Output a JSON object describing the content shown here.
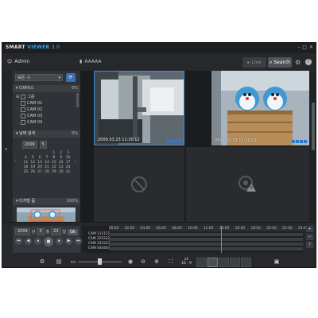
{
  "app": {
    "brand_a": "SMART",
    "brand_b": "VIEWER",
    "version": "3.0"
  },
  "toolbar": {
    "user": "Admin",
    "site": "AAAAA",
    "live_label": "Live",
    "search_label": "Search"
  },
  "side": {
    "dropdown": "모든 -1",
    "devices_title": "디바이스",
    "devices_pct": "0%",
    "group": "그룹",
    "cams": [
      "CAM 01",
      "CAM 02",
      "CAM 03",
      "CAM 04"
    ],
    "date_title": "날짜 검색",
    "date_pct": "0%",
    "year": "2009",
    "month": "5",
    "days": [
      "",
      "",
      "",
      "",
      "1",
      "2",
      "3",
      "4",
      "5",
      "6",
      "7",
      "8",
      "9",
      "10",
      "11",
      "12",
      "13",
      "14",
      "15",
      "16",
      "17",
      "18",
      "19",
      "20",
      "21",
      "22",
      "23",
      "24",
      "25",
      "26",
      "27",
      "28",
      "29",
      "30",
      "31"
    ],
    "zoom_title": "디지털 줌",
    "zoom_pct": "100%"
  },
  "cells": {
    "ts1": "2009.03.23 11:30:12",
    "ts2": "2009.03.23 11:30:12"
  },
  "playback": {
    "year": "2009",
    "year_unit": "년",
    "month": "3",
    "month_unit": "월",
    "day": "23",
    "day_unit": "일",
    "ok": "Ok",
    "ticks": [
      "00:00",
      "02:00",
      "04:00",
      "06:00",
      "08:00",
      "10:00",
      "12:00",
      "14:00",
      "16:00",
      "18:00",
      "20:00",
      "22:00",
      "24:00"
    ],
    "rows": [
      "CAM 111111",
      "CAM 222222",
      "CAM 333333",
      "CAM 444444"
    ],
    "speed_a": "x1",
    "speed_b": "16 : 9"
  }
}
